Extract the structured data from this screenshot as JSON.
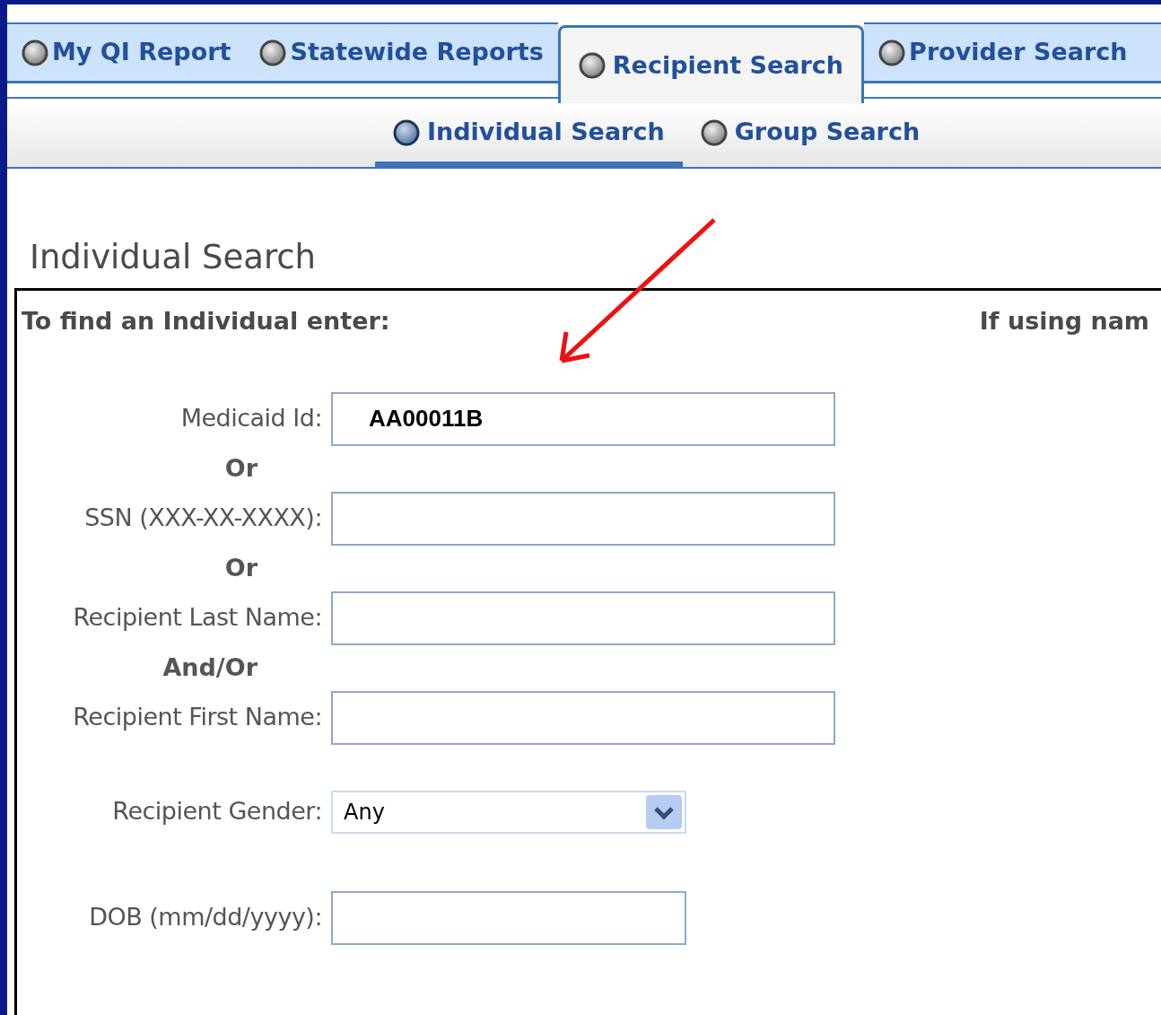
{
  "tabs": [
    {
      "label": "My QI Report",
      "selected": false
    },
    {
      "label": "Statewide Reports",
      "selected": false
    },
    {
      "label": "Recipient Search",
      "selected": true
    },
    {
      "label": "Provider Search",
      "selected": false
    }
  ],
  "subtabs": [
    {
      "label": "Individual Search",
      "selected": true
    },
    {
      "label": "Group Search",
      "selected": false
    }
  ],
  "heading": "Individual Search",
  "panel": {
    "instructions": "To find an Individual enter:",
    "side_note": "If using nam",
    "rows": [
      {
        "kind": "text",
        "label": "Medicaid Id:",
        "value": "AA00011B"
      },
      {
        "kind": "separator",
        "label": "Or"
      },
      {
        "kind": "text",
        "label": "SSN (XXX-XX-XXXX):"
      },
      {
        "kind": "separator",
        "label": "Or"
      },
      {
        "kind": "text",
        "label": "Recipient Last Name:"
      },
      {
        "kind": "separator",
        "label": "And/Or"
      },
      {
        "kind": "text",
        "label": "Recipient First Name:"
      },
      {
        "kind": "select",
        "label": "Recipient Gender:",
        "value": "Any"
      },
      {
        "kind": "date",
        "label": "DOB (mm/dd/yyyy):"
      }
    ]
  }
}
